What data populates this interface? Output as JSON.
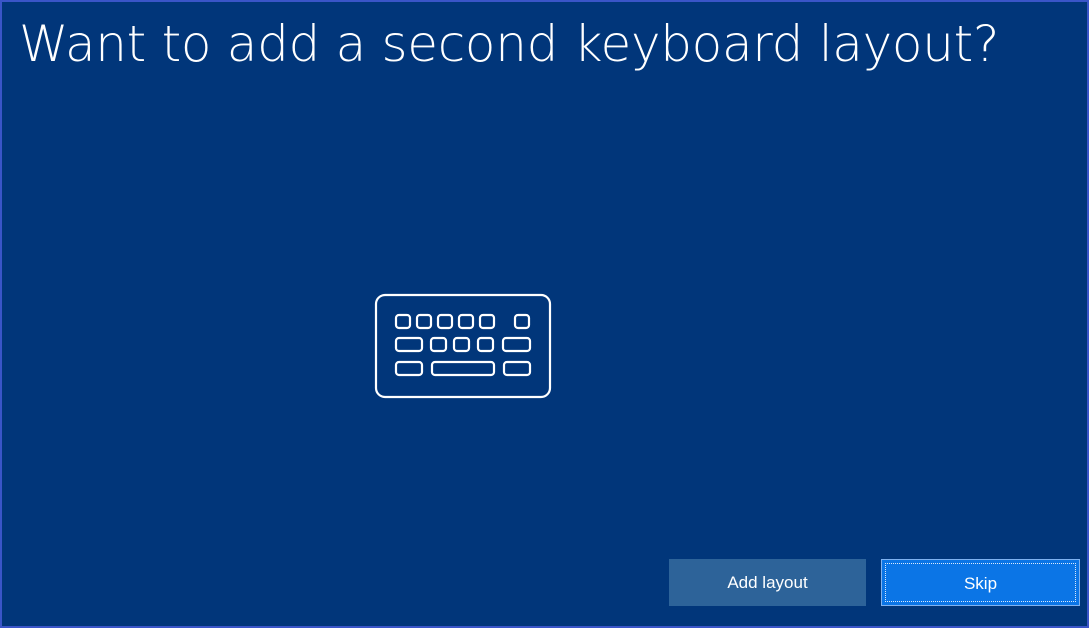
{
  "page": {
    "title": "Want to add a second keyboard layout?"
  },
  "illustration": {
    "icon": "keyboard-icon"
  },
  "actions": {
    "add_layout_label": "Add layout",
    "skip_label": "Skip"
  },
  "colors": {
    "background": "#01367a",
    "add_button": "#2d6399",
    "skip_button": "#0b75e6",
    "text": "#ffffff"
  }
}
